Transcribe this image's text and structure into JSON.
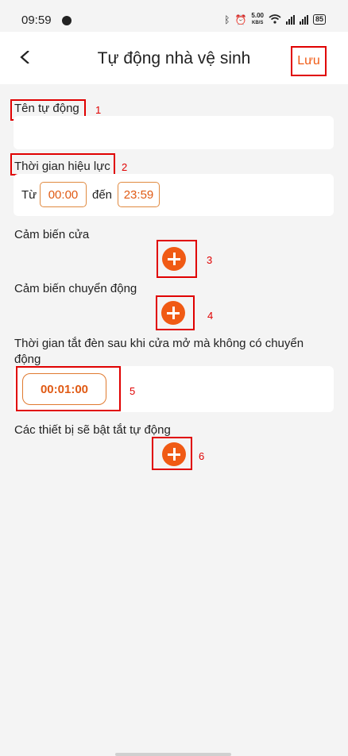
{
  "status_bar": {
    "time": "09:59",
    "speed": "5.00",
    "speed_unit": "KB/S",
    "battery": "85"
  },
  "header": {
    "title": "Tự động nhà vệ sinh",
    "save_label": "Lưu"
  },
  "form": {
    "name_label": "Tên tự động",
    "name_value": "",
    "validity_label": "Thời gian hiệu lực",
    "from_label": "Từ",
    "from_time": "00:00",
    "to_label": "đến",
    "to_time": "23:59",
    "door_sensor_label": "Cảm biến cửa",
    "motion_sensor_label": "Cảm biến chuyển động",
    "light_off_label": "Thời gian tắt đèn sau khi cửa mở mà không có chuyển động",
    "light_off_duration": "00:01:00",
    "devices_label": "Các thiết bị sẽ bật tắt tự động"
  },
  "annotations": [
    "1",
    "2",
    "3",
    "4",
    "5",
    "6"
  ],
  "colors": {
    "accent": "#f05a14",
    "annotation": "#e00000",
    "background": "#f4f4f4"
  }
}
